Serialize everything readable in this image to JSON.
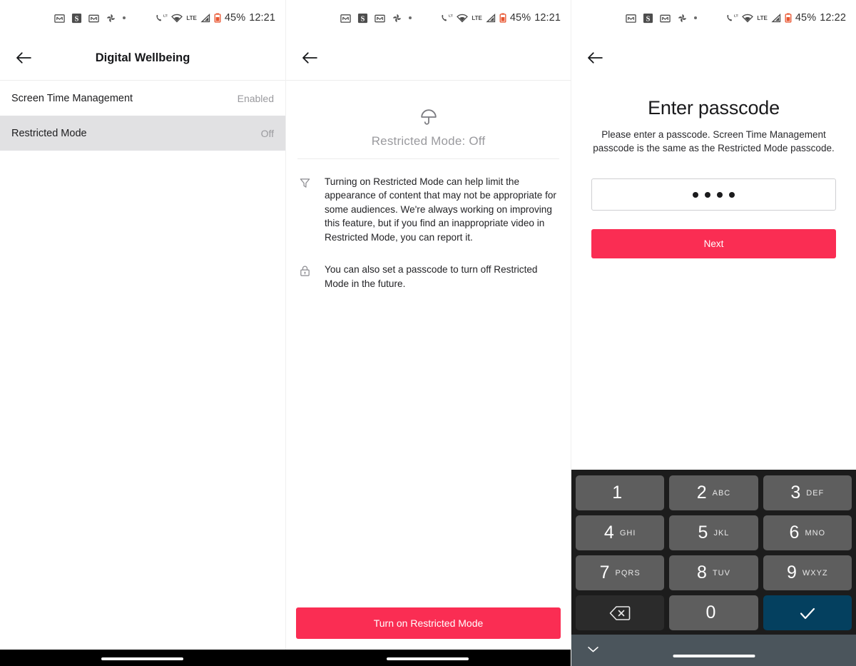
{
  "statusbar": {
    "panel1": {
      "battery": "45%",
      "time": "12:21",
      "network": "LTE",
      "signal": "LTE"
    },
    "panel2": {
      "battery": "45%",
      "time": "12:21",
      "network": "LTE",
      "signal": "LTE"
    },
    "panel3": {
      "battery": "45%",
      "time": "12:22",
      "network": "LTE",
      "signal": "LTE"
    },
    "icons": [
      "mail-icon",
      "s-app-icon",
      "gmail-icon",
      "pinwheel-icon",
      "more-dot-icon"
    ],
    "right_icons": [
      "phone-lte-icon",
      "wifi-icon",
      "lte-label-icon",
      "signal-bars-icon",
      "battery-icon"
    ]
  },
  "panel1": {
    "appbar": {
      "back": "back-arrow",
      "title": "Digital Wellbeing"
    },
    "rows": [
      {
        "label": "Screen Time Management",
        "value": "Enabled",
        "selected": false
      },
      {
        "label": "Restricted Mode",
        "value": "Off",
        "selected": true
      }
    ]
  },
  "panel2": {
    "appbar": {
      "back": "back-arrow",
      "title": ""
    },
    "hero": {
      "icon": "umbrella-icon",
      "title": "Restricted Mode: Off"
    },
    "info": [
      {
        "icon": "filter-funnel-icon",
        "text": "Turning on Restricted Mode can help limit the appearance of content that may not be appropriate for some audiences. We're always working on improving this feature, but if you find an inappropriate video in Restricted Mode, you can report it."
      },
      {
        "icon": "lock-icon",
        "text": "You can also set a passcode to turn off Restricted Mode in the future."
      }
    ],
    "cta_label": "Turn on Restricted Mode"
  },
  "panel3": {
    "appbar": {
      "back": "back-arrow"
    },
    "title": "Enter passcode",
    "subtitle": "Please enter a passcode. Screen Time Management passcode is the same as the Restricted Mode passcode.",
    "passcode_field": {
      "dots": 4,
      "value": "****",
      "placeholder": ""
    },
    "next_label": "Next",
    "keypad": {
      "keys": [
        {
          "num": "1",
          "letters": ""
        },
        {
          "num": "2",
          "letters": "ABC"
        },
        {
          "num": "3",
          "letters": "DEF"
        },
        {
          "num": "4",
          "letters": "GHI"
        },
        {
          "num": "5",
          "letters": "JKL"
        },
        {
          "num": "6",
          "letters": "MNO"
        },
        {
          "num": "7",
          "letters": "PQRS"
        },
        {
          "num": "8",
          "letters": "TUV"
        },
        {
          "num": "9",
          "letters": "WXYZ"
        },
        {
          "num": "0",
          "letters": ""
        }
      ],
      "backspace_icon": "backspace-icon",
      "enter_icon": "checkmark-icon",
      "hide_keyboard_icon": "chevron-down-icon"
    }
  },
  "colors": {
    "accent_red": "#fa2d53",
    "enter_key_blue": "#04405f",
    "key_gray": "#5e5e5e",
    "keypad_bg": "#1c1c1c",
    "selected_row": "#e1e1e3",
    "muted_text": "#9a9a9e"
  }
}
